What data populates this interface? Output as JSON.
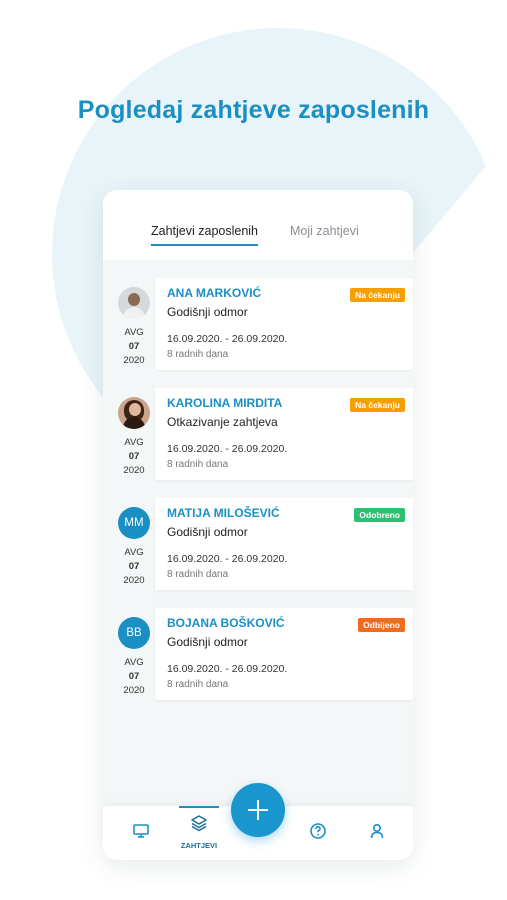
{
  "headline": "Pogledaj zahtjeve zaposlenih",
  "tabs": [
    {
      "label": "Zahtjevi zaposlenih",
      "active": true
    },
    {
      "label": "Moji zahtjevi",
      "active": false
    }
  ],
  "requests": [
    {
      "name": "ANA MARKOVIĆ",
      "type": "Godišnji odmor",
      "status": "Na čekanju",
      "status_color": "#f5a000",
      "date_range": "16.09.2020. - 26.09.2020.",
      "days": "8 radnih dana",
      "month": "AVG",
      "day": "07",
      "year": "2020",
      "avatar_icon": "female-photo-avatar"
    },
    {
      "name": "KAROLINA MIRDITA",
      "type": "Otkazivanje zahtjeva",
      "status": "Na čekanju",
      "status_color": "#f5a000",
      "date_range": "16.09.2020. - 26.09.2020.",
      "days": "8 radnih dana",
      "month": "AVG",
      "day": "07",
      "year": "2020",
      "avatar_icon": "female-photo-avatar"
    },
    {
      "name": "MATIJA MILOŠEVIĆ",
      "type": "Godišnji odmor",
      "status": "Odobreno",
      "status_color": "#2fbf71",
      "date_range": "16.09.2020. - 26.09.2020.",
      "days": "8 radnih dana",
      "month": "AVG",
      "day": "07",
      "year": "2020",
      "initials": "MM"
    },
    {
      "name": "BOJANA BOŠKOVIĆ",
      "type": "Godišnji odmor",
      "status": "Odbijeno",
      "status_color": "#f26a1b",
      "date_range": "16.09.2020. - 26.09.2020.",
      "days": "8 radnih dana",
      "month": "AVG",
      "day": "07",
      "year": "2020",
      "initials": "BB"
    }
  ],
  "bottom_nav": {
    "active_label": "ZAHTJEVI",
    "items": [
      "monitor-icon",
      "layers-icon",
      "help-circle-icon",
      "user-icon"
    ]
  },
  "fab_icon": "plus-icon",
  "colors": {
    "accent": "#1a8fc4",
    "pending": "#f5a000",
    "approved": "#2fbf71",
    "rejected": "#f26a1b"
  }
}
